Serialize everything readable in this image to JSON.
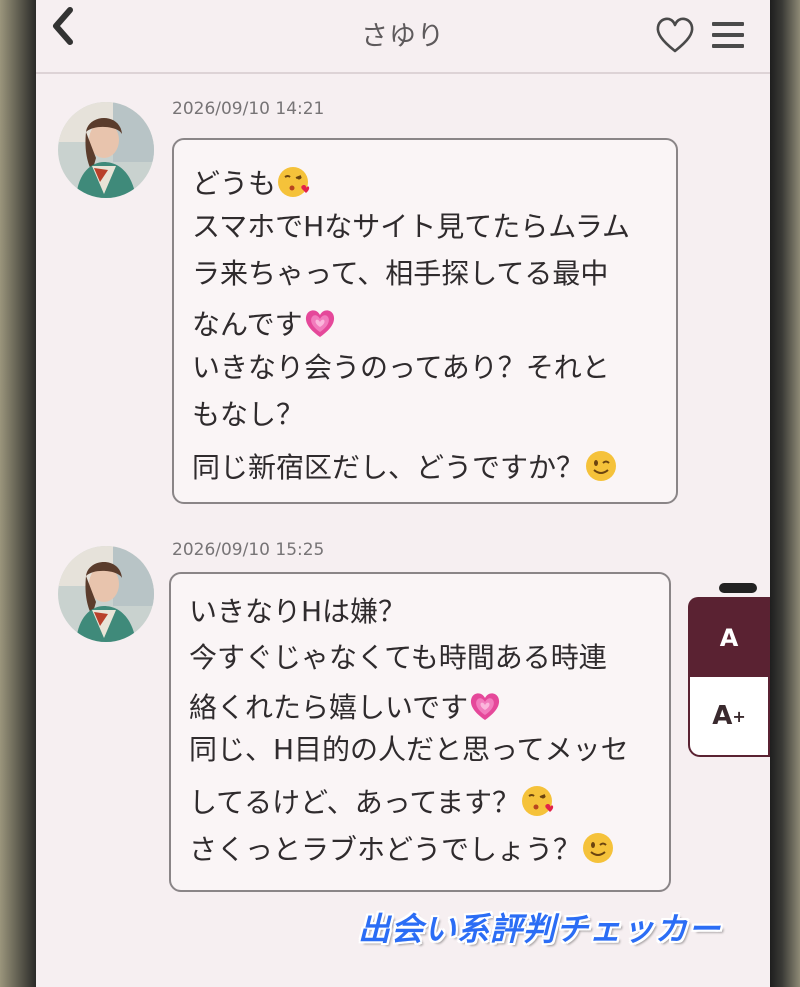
{
  "header": {
    "title": "さゆり",
    "back_icon": "chevron-left-icon",
    "favorite_icon": "heart-outline-icon",
    "menu_icon": "hamburger-menu-icon"
  },
  "messages": [
    {
      "timestamp": "2026/09/10 14:21",
      "lines": [
        "どうも",
        "スマホでHなサイト見てたらムラム",
        "ラ来ちゃって、相手探してる最中",
        "なんです",
        "いきなり会うのってあり？それと",
        "もなし？",
        "同じ新宿区だし、どうですか？"
      ]
    },
    {
      "timestamp": "2026/09/10 15:25",
      "lines": [
        "いきなりHは嫌？",
        "今すぐじゃなくても時間ある時連",
        "絡くれたら嬉しいです",
        "同じ、H目的の人だと思ってメッセ",
        "してるけど、あってます？",
        "さくっとラブホどうでしょう？"
      ]
    }
  ],
  "font_size_control": {
    "small_label": "A",
    "large_label": "A",
    "large_sup": "+"
  },
  "watermark": "出会い系評判チェッカー",
  "colors": {
    "screen_bg": "#f6eff1",
    "accent": "#5a2232",
    "watermark": "#2b6df5"
  }
}
